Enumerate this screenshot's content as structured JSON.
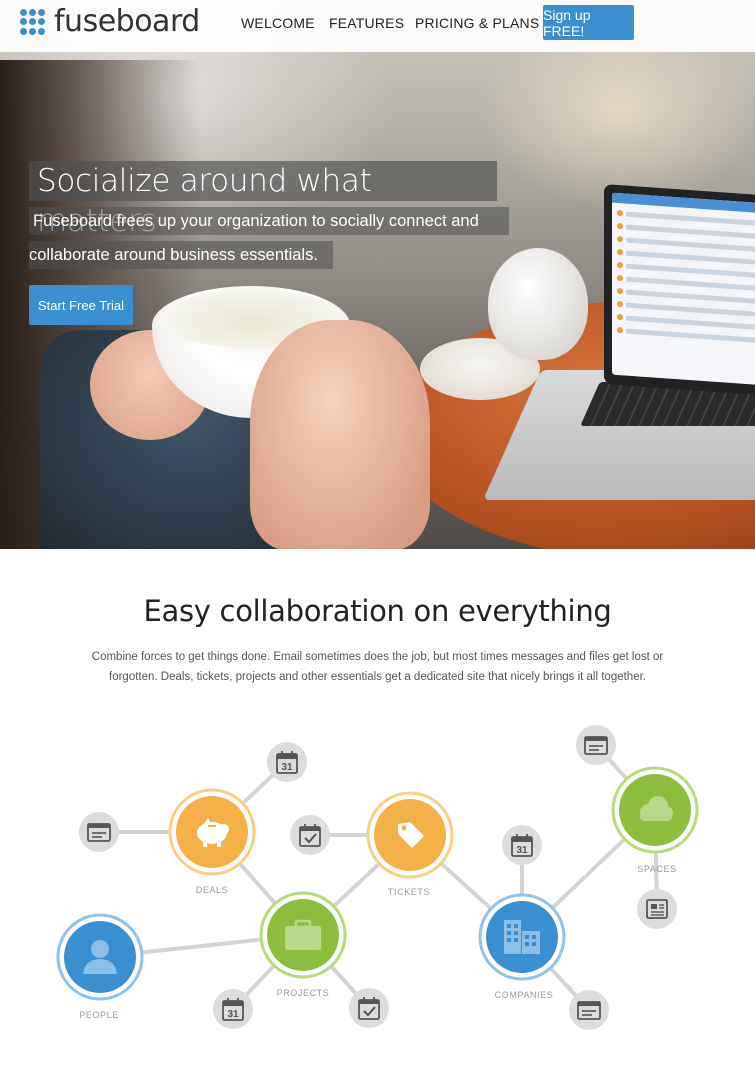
{
  "nav": {
    "logo_text": "fuseboard",
    "links": [
      "WELCOME",
      "FEATURES",
      "PRICING & PLANS"
    ],
    "signup_label": "Sign up FREE!"
  },
  "hero": {
    "title": "Socialize around what matters",
    "subtitle_line1": "Fuseboard frees up your organization to socially connect and",
    "subtitle_line2": "collaborate around business essentials.",
    "cta_label": "Start Free Trial"
  },
  "section": {
    "title": "Easy collaboration on everything",
    "text": "Combine forces to get things done. Email sometimes does the job, but most times messages and files get lost or forgotten. Deals, tickets, projects and other essentials get a dedicated site that nicely brings it all together."
  },
  "diagram": {
    "labels": {
      "deals": "DEALS",
      "tickets": "TICKETS",
      "projects": "PROJECTS",
      "people": "PEOPLE",
      "companies": "COMPANIES",
      "spaces": "SPACES"
    },
    "calendar_day": "31",
    "colors": {
      "orange": "#f5b04a",
      "green": "#8cbd3f",
      "blue": "#3a8fd0",
      "gray_node": "#dcdcdc",
      "line": "#d3d3d3"
    }
  }
}
